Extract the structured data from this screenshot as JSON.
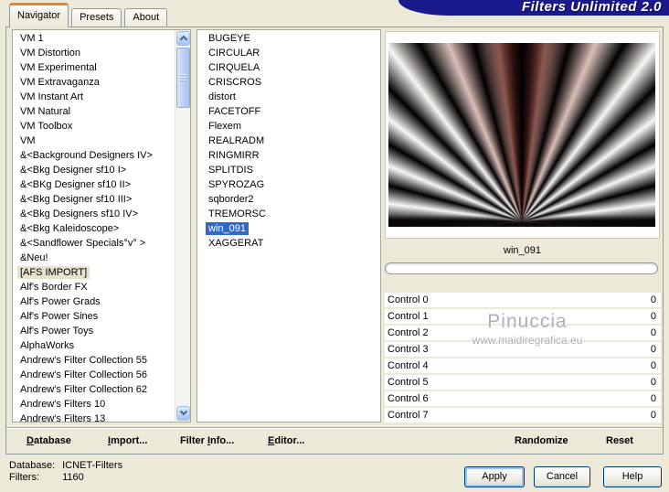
{
  "window": {
    "brand": "Filters Unlimited 2.0",
    "tabs": [
      {
        "label": "Navigator",
        "active": true
      },
      {
        "label": "Presets",
        "active": false
      },
      {
        "label": "About",
        "active": false
      }
    ]
  },
  "category_list": {
    "items": [
      "VM 1",
      "VM Distortion",
      "VM Experimental",
      "VM Extravaganza",
      "VM Instant Art",
      "VM Natural",
      "VM Toolbox",
      "VM",
      "&<Background Designers IV>",
      "&<Bkg Designer sf10 I>",
      "&<BKg Designer sf10 II>",
      "&<Bkg Designer sf10 III>",
      "&<Bkg Designers sf10 IV>",
      "&<Bkg Kaleidoscope>",
      "&<Sandflower Specials°v° >",
      "&Neu!",
      "[AFS IMPORT]",
      "Alf's Border FX",
      "Alf's Power Grads",
      "Alf's Power Sines",
      "Alf's Power Toys",
      "AlphaWorks",
      "Andrew's Filter Collection 55",
      "Andrew's Filter Collection 56",
      "Andrew's Filter Collection 62",
      "Andrew's Filters 10",
      "Andrew's Filters 13"
    ],
    "selected_item": "[AFS IMPORT]"
  },
  "filter_list": {
    "items": [
      "BUGEYE",
      "CIRCULAR",
      "CIRQUELA",
      "CRISCROS",
      "distort",
      "FACETOFF",
      "Flexem",
      "REALRADM",
      "RINGMIRR",
      "SPLITDIS",
      "SPYROZAG",
      "sqborder2",
      "TREMORSC",
      "win_091",
      "XAGGERAT"
    ],
    "selected_item": "win_091"
  },
  "preview": {
    "filter_name": "win_091",
    "watermark": {
      "title": "Pinuccia",
      "url": "www.maidiregrafica.eu"
    }
  },
  "controls": [
    {
      "label": "Control 0",
      "value": "0"
    },
    {
      "label": "Control 1",
      "value": "0"
    },
    {
      "label": "Control 2",
      "value": "0"
    },
    {
      "label": "Control 3",
      "value": "0"
    },
    {
      "label": "Control 4",
      "value": "0"
    },
    {
      "label": "Control 5",
      "value": "0"
    },
    {
      "label": "Control 6",
      "value": "0"
    },
    {
      "label": "Control 7",
      "value": "0"
    }
  ],
  "actions": {
    "database": {
      "text": "Database",
      "u": 0
    },
    "import": {
      "text": "Import...",
      "u": 0
    },
    "filter_info": {
      "text": "Filter Info...",
      "u": 7
    },
    "editor": {
      "text": "Editor...",
      "u": 0
    },
    "randomize": {
      "text": "Randomize",
      "u": -1
    },
    "reset": {
      "text": "Reset",
      "u": -1
    }
  },
  "status": {
    "database_label": "Database:",
    "database_value": "ICNET-Filters",
    "filters_label": "Filters:",
    "filters_value": "1160"
  },
  "dialog_buttons": {
    "apply": "Apply",
    "cancel": "Cancel",
    "help": "Help"
  },
  "colors": {
    "background": "#ece9d8",
    "banner": "#1a1a8c",
    "selection": "#316ac5",
    "inactive_selection": "#e6e2cc",
    "tab_accent": "#e5832a"
  }
}
